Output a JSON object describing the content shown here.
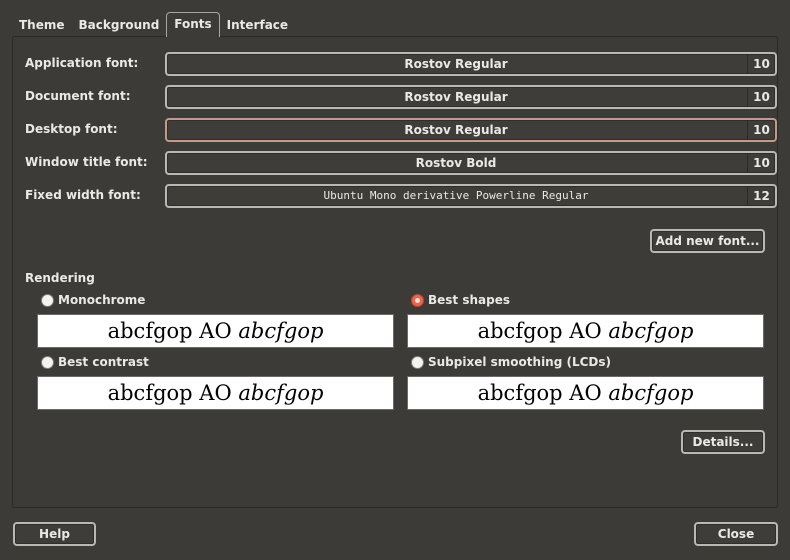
{
  "tabs": [
    {
      "label": "Theme"
    },
    {
      "label": "Background"
    },
    {
      "label": "Fonts",
      "active": true
    },
    {
      "label": "Interface"
    }
  ],
  "fonts": [
    {
      "label": "Application font:",
      "font": "Rostov Regular",
      "size": "10"
    },
    {
      "label": "Document font:",
      "font": "Rostov Regular",
      "size": "10"
    },
    {
      "label": "Desktop font:",
      "font": "Rostov Regular",
      "size": "10"
    },
    {
      "label": "Window title font:",
      "font": "Rostov Bold",
      "size": "10"
    },
    {
      "label": "Fixed width font:",
      "font": "Ubuntu Mono derivative Powerline Regular",
      "size": "12"
    }
  ],
  "add_font_label": "Add new font...",
  "rendering": {
    "title": "Rendering",
    "options": [
      {
        "label": "Monochrome",
        "checked": false,
        "preview": "abcfgop AO",
        "preview_italic": "abcfgop"
      },
      {
        "label": "Best shapes",
        "checked": true,
        "preview": "abcfgop AO",
        "preview_italic": "abcfgop"
      },
      {
        "label": "Best contrast",
        "checked": false,
        "preview": "abcfgop AO",
        "preview_italic": "abcfgop"
      },
      {
        "label": "Subpixel smoothing (LCDs)",
        "checked": false,
        "preview": "abcfgop AO",
        "preview_italic": "abcfgop"
      }
    ]
  },
  "details_label": "Details...",
  "help_label": "Help",
  "close_label": "Close",
  "colors": {
    "accent": "#e9664a",
    "background": "#3c3b37",
    "text": "#e9e9e6"
  }
}
